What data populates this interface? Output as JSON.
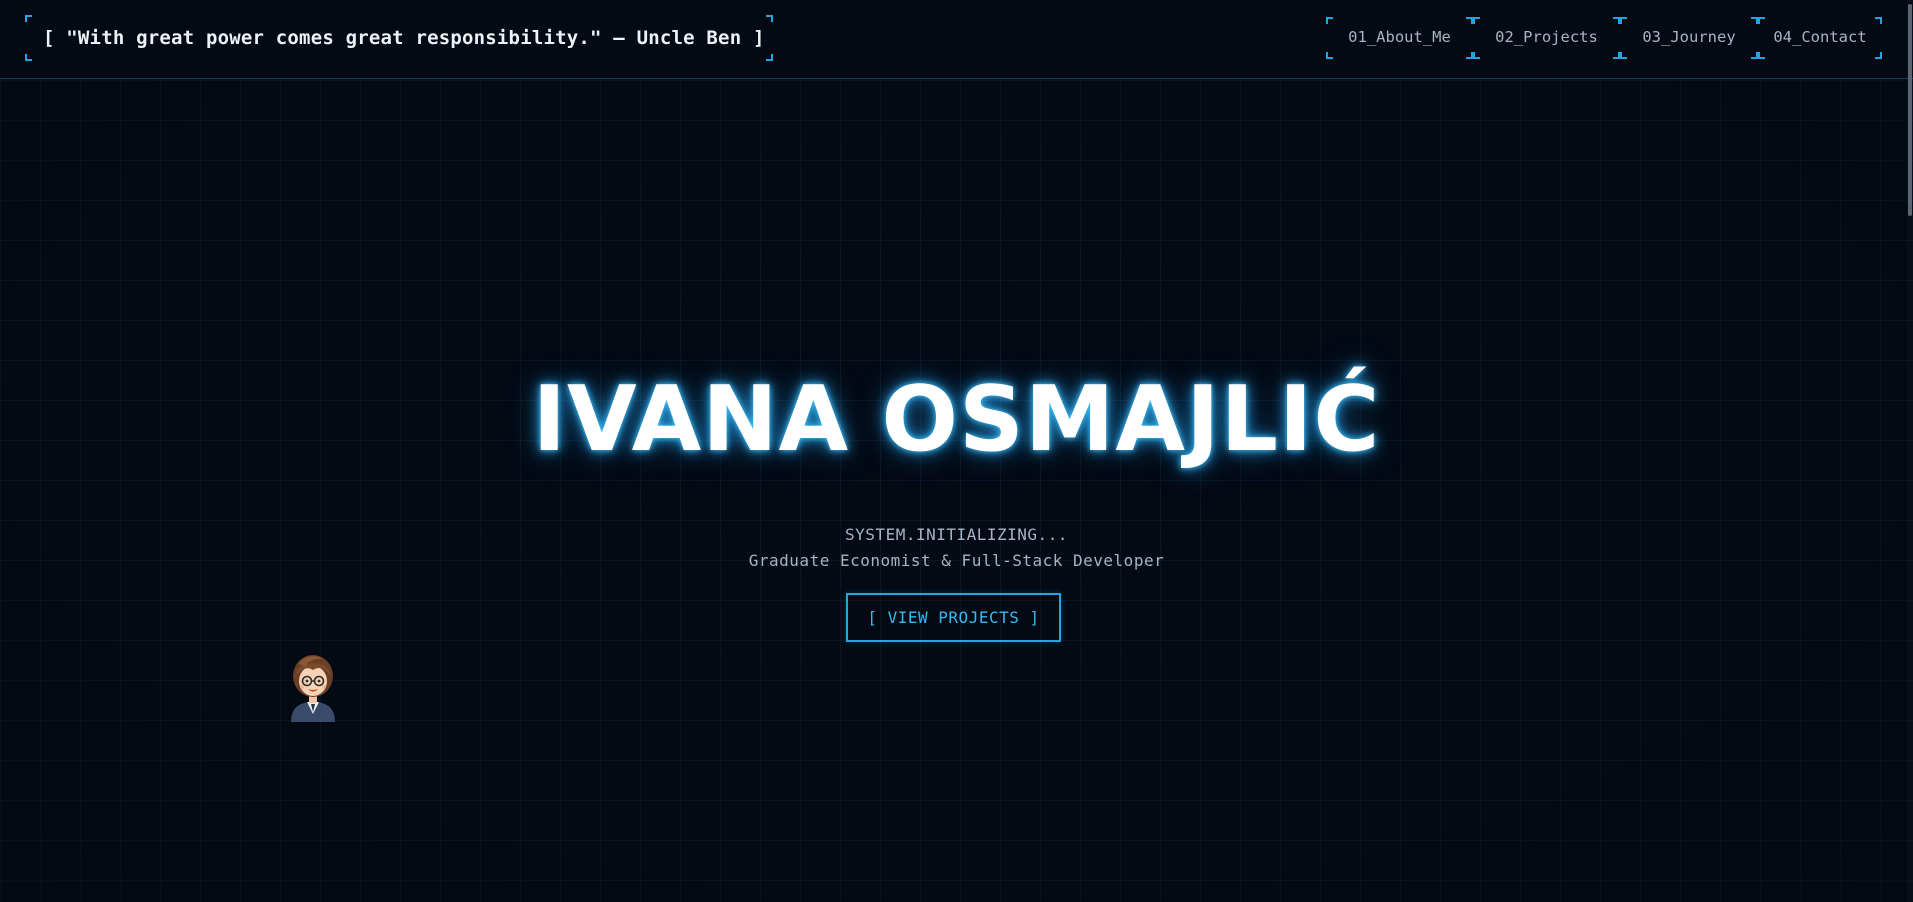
{
  "header": {
    "quote": "[ \"With great power comes great responsibility.\" — Uncle Ben ]",
    "nav": [
      {
        "label": "01_About_Me"
      },
      {
        "label": "02_Projects"
      },
      {
        "label": "03_Journey"
      },
      {
        "label": "04_Contact"
      }
    ]
  },
  "hero": {
    "name": "IVANA OSMAJLIĆ",
    "status": "SYSTEM.INITIALIZING...",
    "role": "Graduate Economist & Full-Stack Developer",
    "cta_label": "[ VIEW PROJECTS ]"
  },
  "avatar": {
    "icon": "developer-avatar-icon"
  },
  "colors": {
    "background": "#040a14",
    "accent": "#22a6e0",
    "text": "#a8b3c4",
    "heading": "#ffffff"
  }
}
